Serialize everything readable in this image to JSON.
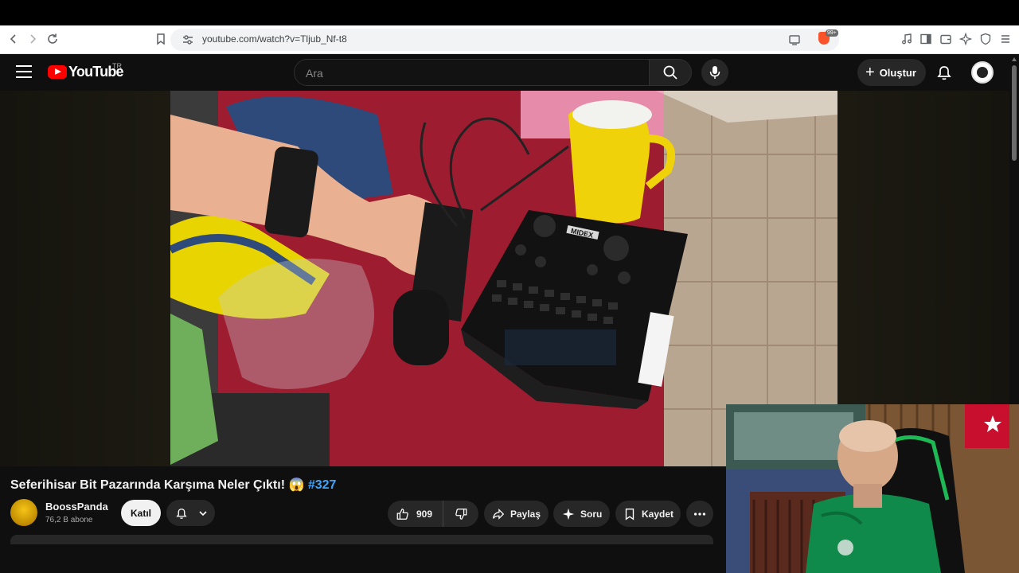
{
  "browser": {
    "url": "youtube.com/watch?v=Tljub_Nf-t8",
    "extension_badge": "99+"
  },
  "header": {
    "logo_text": "YouTube",
    "region": "TR",
    "search_placeholder": "Ara",
    "create_label": "Oluştur"
  },
  "video": {
    "title": "Seferihisar Bit Pazarında Karşıma Neler Çıktı! 😱",
    "hashtag": "#327",
    "channel_name": "BoossPanda",
    "subscribers": "76,2 B abone",
    "join_label": "Katıl",
    "likes": "909",
    "share_label": "Paylaş",
    "ask_label": "Soru",
    "save_label": "Kaydet",
    "device_brand": "MIDEX"
  },
  "colors": {
    "accent_red": "#ff0000",
    "link_blue": "#3ea6ff",
    "bg": "#0f0f0f"
  }
}
